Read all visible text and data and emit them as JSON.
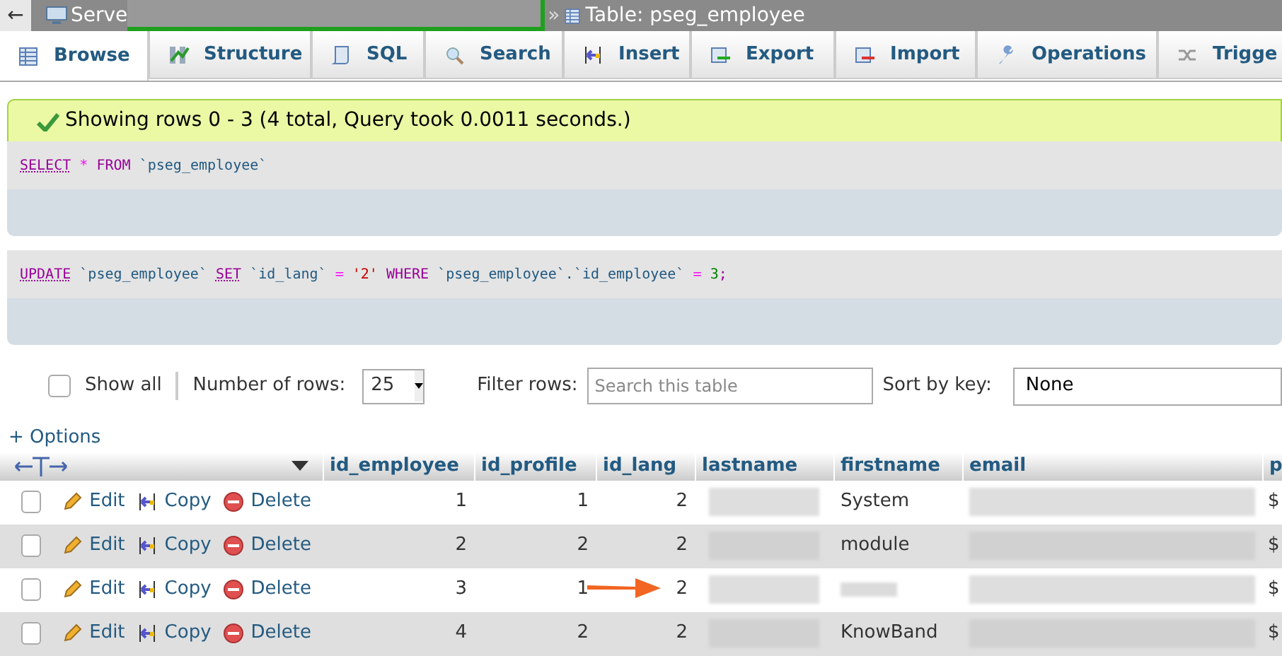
{
  "breadcrumb": {
    "back": "←",
    "server": "Serve",
    "separator": "»",
    "table": "Table: pseg_employee"
  },
  "tabs": [
    {
      "label": "Browse",
      "selected": true
    },
    {
      "label": "Structure",
      "selected": false
    },
    {
      "label": "SQL",
      "selected": false
    },
    {
      "label": "Search",
      "selected": false
    },
    {
      "label": "Insert",
      "selected": false
    },
    {
      "label": "Export",
      "selected": false
    },
    {
      "label": "Import",
      "selected": false
    },
    {
      "label": "Operations",
      "selected": false
    },
    {
      "label": "Trigge",
      "selected": false
    }
  ],
  "message": "Showing rows 0 - 3 (4 total, Query took 0.0011 seconds.)",
  "queries": [
    [
      {
        "kind": "keyword",
        "text": "SELECT"
      },
      {
        "kind": "operator",
        "text": "*"
      },
      {
        "kind": "plain",
        "text": "FROM"
      },
      {
        "kind": "name",
        "text": "`pseg_employee`"
      }
    ],
    [
      {
        "kind": "keyword",
        "text": "UPDATE"
      },
      {
        "kind": "name",
        "text": "`pseg_employee`"
      },
      {
        "kind": "keyword",
        "text": "SET"
      },
      {
        "kind": "name",
        "text": "`id_lang`"
      },
      {
        "kind": "operator",
        "text": "="
      },
      {
        "kind": "string",
        "text": "'2'"
      },
      {
        "kind": "plain",
        "text": "WHERE"
      },
      {
        "kind": "name",
        "text": "`pseg_employee`.`id_employee`"
      },
      {
        "kind": "operator",
        "text": "="
      },
      {
        "kind": "number",
        "text": "3"
      },
      {
        "kind": "plain",
        "text": ";",
        "attached": true
      }
    ]
  ],
  "controls": {
    "show_all": {
      "label": "Show all",
      "checked": false
    },
    "rows_label": "Number of rows:",
    "rows_value": "25",
    "filter_label": "Filter rows:",
    "filter_placeholder": "Search this table",
    "sort_label": "Sort by key:",
    "sort_value": "None"
  },
  "options_link": "+ Options",
  "table": {
    "columns": [
      "id_employee",
      "id_profile",
      "id_lang",
      "lastname",
      "firstname",
      "email",
      "p"
    ],
    "rows": [
      {
        "actions": [
          "Edit",
          "Copy",
          "Delete"
        ],
        "checked": false,
        "id_employee": "1",
        "id_profile": "1",
        "id_lang": "2",
        "firstname": "System",
        "column_7": "$",
        "pointed": false
      },
      {
        "actions": [
          "Edit",
          "Copy",
          "Delete"
        ],
        "checked": false,
        "id_employee": "2",
        "id_profile": "2",
        "id_lang": "2",
        "firstname": "module",
        "column_7": "$",
        "pointed": false
      },
      {
        "actions": [
          "Edit",
          "Copy",
          "Delete"
        ],
        "checked": false,
        "id_employee": "3",
        "id_profile": "1",
        "id_lang": "2",
        "column_7": "$",
        "pointed": true
      },
      {
        "actions": [
          "Edit",
          "Copy",
          "Delete"
        ],
        "checked": false,
        "id_employee": "4",
        "id_profile": "2",
        "id_lang": "2",
        "firstname": "KnowBand",
        "column_7": "$",
        "pointed": false
      }
    ]
  }
}
